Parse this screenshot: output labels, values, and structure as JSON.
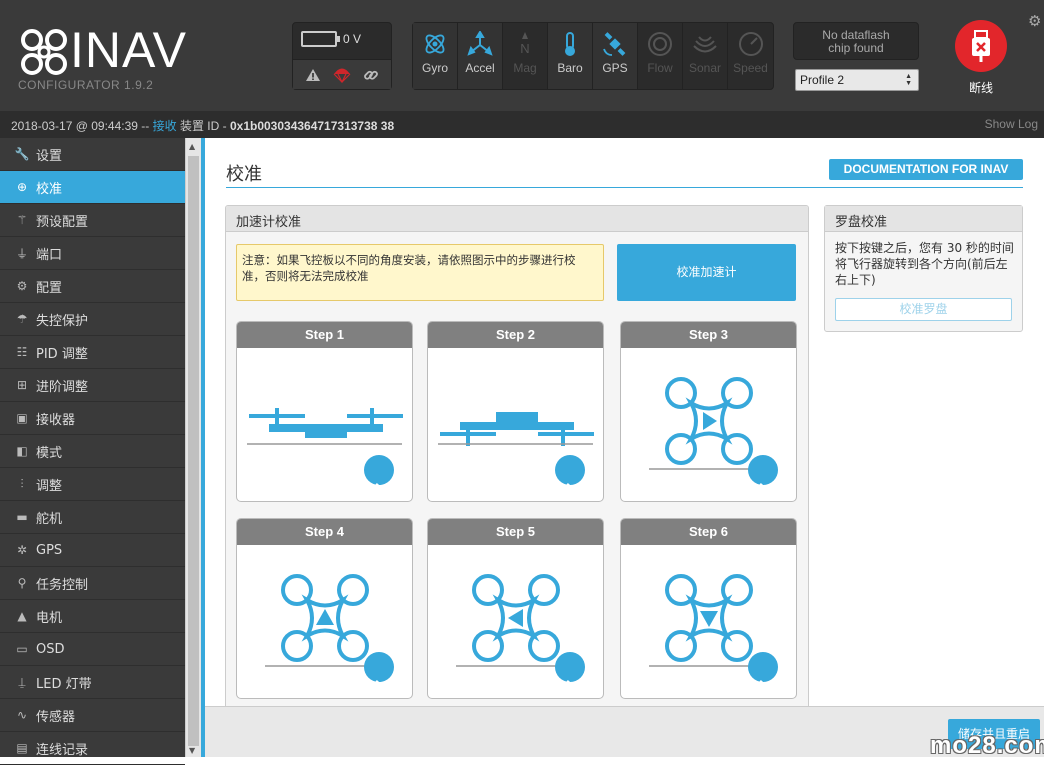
{
  "header": {
    "app_name": "INAV",
    "app_sub": "CONFIGURATOR  1.9.2",
    "voltage": "0 V",
    "sensors": [
      {
        "label": "Gyro",
        "icon": "gyro-icon",
        "active": true
      },
      {
        "label": "Accel",
        "icon": "accel-icon",
        "active": true
      },
      {
        "label": "Mag",
        "icon": "mag-icon",
        "active": false
      },
      {
        "label": "Baro",
        "icon": "baro-icon",
        "active": true
      },
      {
        "label": "GPS",
        "icon": "gps-icon",
        "active": true
      },
      {
        "label": "Flow",
        "icon": "flow-icon",
        "active": false
      },
      {
        "label": "Sonar",
        "icon": "sonar-icon",
        "active": false
      },
      {
        "label": "Speed",
        "icon": "speed-icon",
        "active": false
      }
    ],
    "dataflash_line1": "No dataflash",
    "dataflash_line2": "chip found",
    "profile": "Profile 2",
    "connect_label": "断线"
  },
  "statusbar": {
    "timestamp": "2018-03-17 @ 09:44:39 -- ",
    "received": "接收",
    "device_label": " 装置 ID - ",
    "device_id": "0x1b003034364717313738 38",
    "show_log": "Show Log"
  },
  "sidebar": {
    "items": [
      {
        "label": "设置",
        "icon": "wrench-icon"
      },
      {
        "label": "校准",
        "icon": "crosshair-icon"
      },
      {
        "label": "预设配置",
        "icon": "wand-icon"
      },
      {
        "label": "端口",
        "icon": "plug-icon"
      },
      {
        "label": "配置",
        "icon": "gear-icon"
      },
      {
        "label": "失控保护",
        "icon": "parachute-icon"
      },
      {
        "label": "PID 调整",
        "icon": "sitemap-icon"
      },
      {
        "label": "进阶调整",
        "icon": "tune-icon"
      },
      {
        "label": "接收器",
        "icon": "receiver-icon"
      },
      {
        "label": "模式",
        "icon": "toggle-icon"
      },
      {
        "label": "调整",
        "icon": "sliders-icon"
      },
      {
        "label": "舵机",
        "icon": "servo-icon"
      },
      {
        "label": "GPS",
        "icon": "satellite-icon"
      },
      {
        "label": "任务控制",
        "icon": "map-marker-icon"
      },
      {
        "label": "电机",
        "icon": "motor-icon"
      },
      {
        "label": "OSD",
        "icon": "osd-icon"
      },
      {
        "label": "LED 灯带",
        "icon": "led-icon"
      },
      {
        "label": "传感器",
        "icon": "pulse-icon"
      },
      {
        "label": "连线记录",
        "icon": "log-icon"
      }
    ]
  },
  "main": {
    "title": "校准",
    "doc_button": "DOCUMENTATION FOR INAV",
    "accel": {
      "title": "加速计校准",
      "note": "注意：如果飞控板以不同的角度安装，请依照图示中的步骤进行校准，否则将无法完成校准",
      "button": "校准加速计",
      "steps": [
        "Step 1",
        "Step 2",
        "Step 3",
        "Step 4",
        "Step 5",
        "Step 6"
      ]
    },
    "compass": {
      "title": "罗盘校准",
      "text": "按下按键之后，您有 30 秒的时间将飞行器旋转到各个方向(前后左右上下)",
      "button": "校准罗盘"
    },
    "save_button": "储存并且重启"
  },
  "watermark": "mo28.com",
  "colors": {
    "accent": "#37a8db",
    "header": "#3a3a3a",
    "connect": "#e2262b"
  }
}
